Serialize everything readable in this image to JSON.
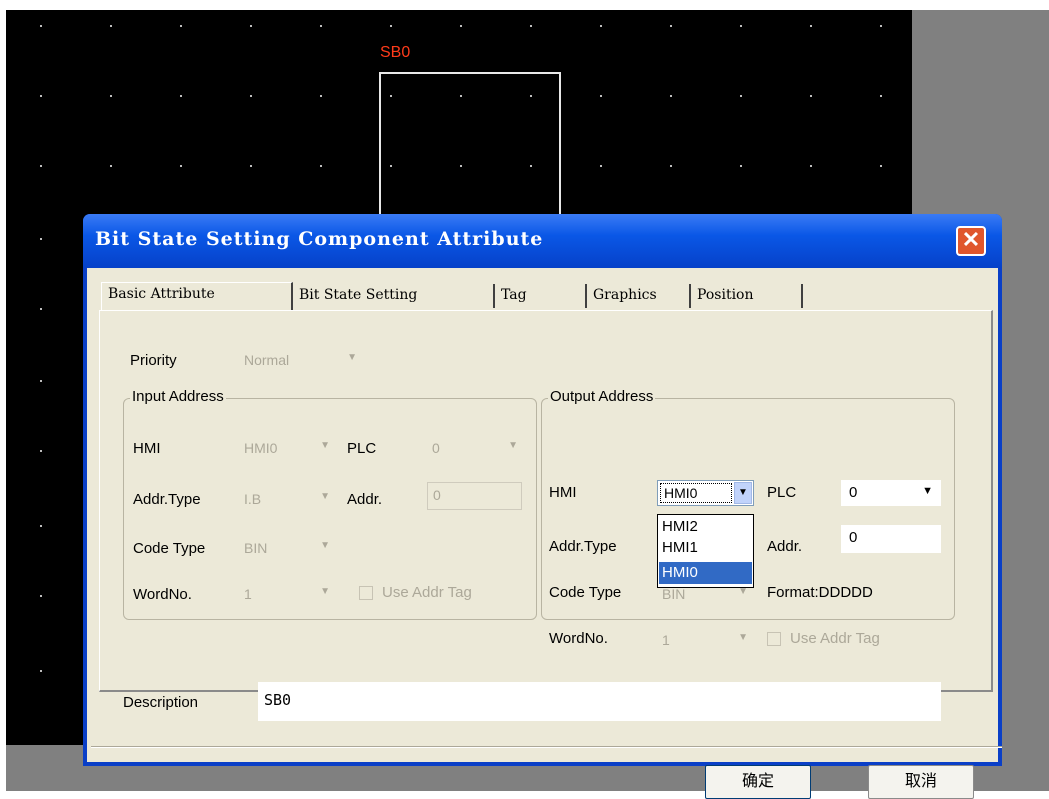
{
  "canvas": {
    "component_label": "SB0"
  },
  "dialog": {
    "title": "Bit State Setting Component Attribute",
    "close_glyph": "✕",
    "tabs": [
      "Basic Attribute",
      "Bit State Setting",
      "Tag",
      "Graphics",
      "Position"
    ],
    "active_tab": "Basic Attribute",
    "priority": {
      "label": "Priority",
      "value": "Normal"
    },
    "input_address": {
      "title": "Input Address",
      "hmi_label": "HMI",
      "hmi_value": "HMI0",
      "plc_label": "PLC",
      "plc_value": "0",
      "addr_type_label": "Addr.Type",
      "addr_type_value": "I.B",
      "addr_label": "Addr.",
      "addr_value": "0",
      "code_type_label": "Code Type",
      "code_type_value": "BIN",
      "wordno_label": "WordNo.",
      "wordno_value": "1",
      "use_tag_label": "Use Addr Tag"
    },
    "output_address": {
      "title": "Output Address",
      "hmi_label": "HMI",
      "hmi_value": "HMI0",
      "hmi_options": [
        "HMI2",
        "HMI1",
        "HMI0"
      ],
      "plc_label": "PLC",
      "plc_value": "0",
      "addr_type_label": "Addr.Type",
      "addr_label": "Addr.",
      "addr_value": "0",
      "code_type_label": "Code Type",
      "code_type_value": "BIN",
      "format_label": "Format:DDDDD",
      "wordno_label": "WordNo.",
      "wordno_value": "1",
      "use_tag_label": "Use Addr Tag"
    },
    "description": {
      "label": "Description",
      "value": "SB0"
    },
    "ok_label": "确定",
    "cancel_label": "取消"
  },
  "colors": {
    "title_bar": "#0a57e6",
    "selection": "#316ac5",
    "component_label": "#ff3b1a"
  }
}
